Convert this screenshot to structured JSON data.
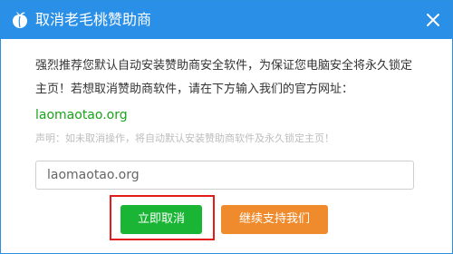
{
  "dialog": {
    "title": "取消老毛桃赞助商",
    "message": "强烈推荐您默认自动安装赞助商安全软件，为保证您电脑安全将永久锁定主页！若想取消赞助商软件，请在下方输入我们的官方网址：",
    "site": "laomaotao.org",
    "note": "声明：如未取消操作，将自动默认安装赞助商软件及永久锁定主页！",
    "input_value": "laomaotao.org",
    "cancel_label": "立即取消",
    "continue_label": "继续支持我们"
  },
  "icons": {
    "logo": "peach-logo-icon",
    "close": "close-icon"
  },
  "colors": {
    "titlebar": "#2a8fe6",
    "site_text": "#1aa31a",
    "cancel_button": "#1ab535",
    "continue_button": "#f08b2d",
    "highlight_border": "#e21b1b"
  }
}
